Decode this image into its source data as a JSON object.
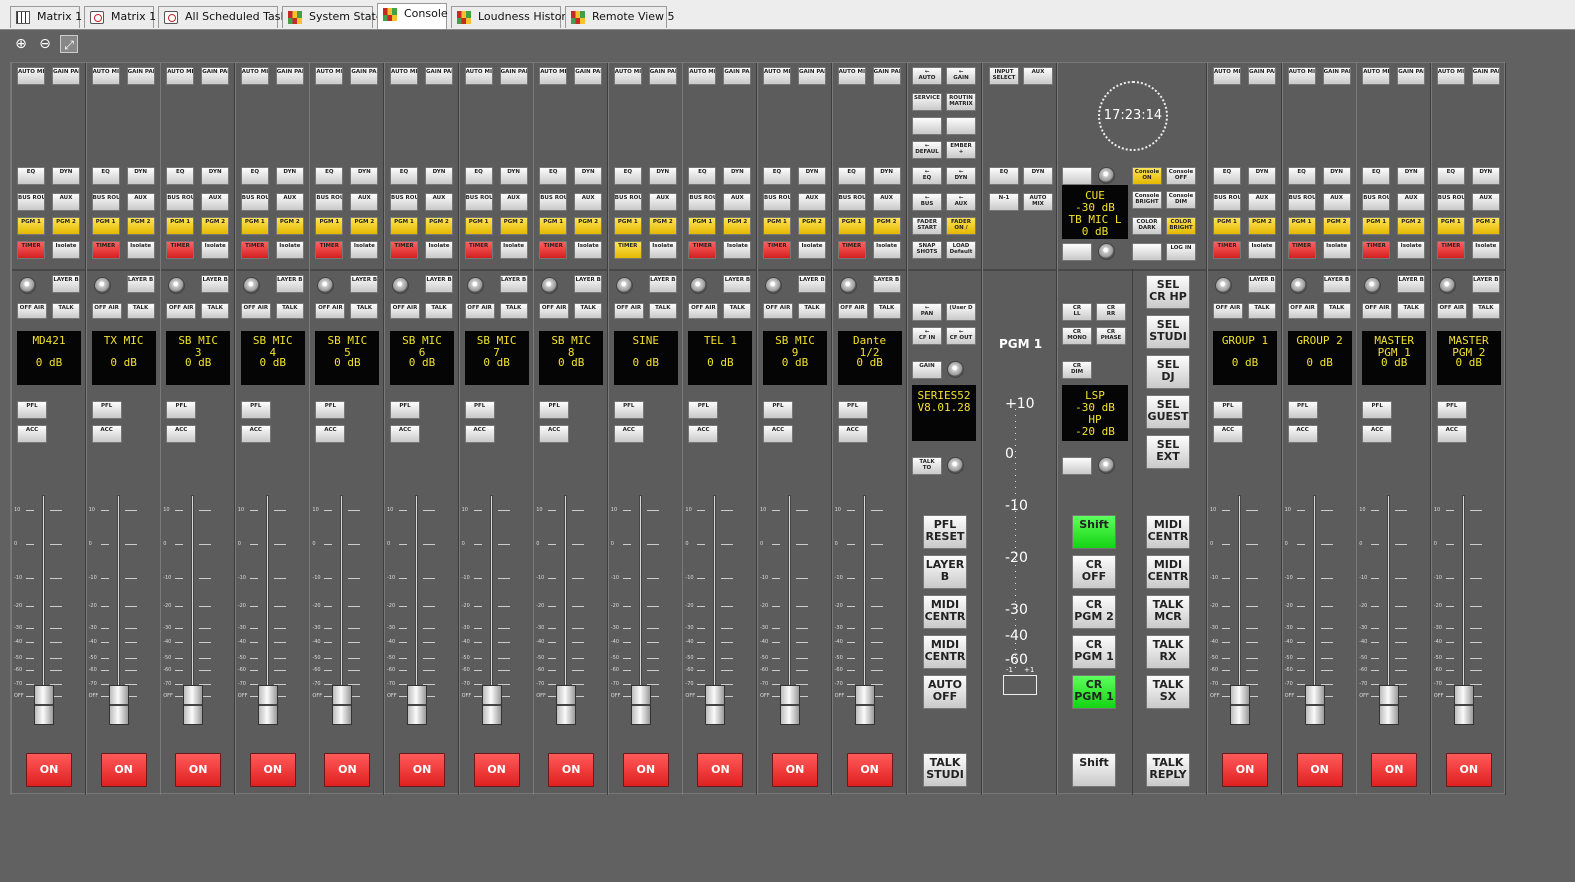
{
  "tabs": [
    {
      "label": "Matrix 1",
      "icon": "grid-icon",
      "active": false
    },
    {
      "label": "Matrix 1",
      "icon": "scheduler-icon",
      "active": false
    },
    {
      "label": "All Scheduled Tasks",
      "icon": "scheduler-icon",
      "active": false
    },
    {
      "label": "System State",
      "icon": "status-color-icon",
      "active": false
    },
    {
      "label": "Console",
      "icon": "status-color-icon",
      "active": true
    },
    {
      "label": "Loudness History",
      "icon": "status-color-icon",
      "active": false
    },
    {
      "label": "Remote View 5",
      "icon": "status-color-icon",
      "active": false
    }
  ],
  "toolbar": {
    "zoom_in": "zoom-in-icon",
    "zoom_out": "zoom-out-icon",
    "fit": "fit-screen-icon"
  },
  "labels": {
    "auto_mix": "AUTO MIX",
    "gain_pan": "GAIN PAN",
    "eq": "EQ",
    "dyn": "DYN",
    "bus_route": "BUS ROUTE",
    "aux": "AUX",
    "pgm1": "PGM 1",
    "pgm2": "PGM 2",
    "timer": "TIMER",
    "isolate": "Isolate",
    "layer_b": "LAYER B",
    "off_air": "OFF AIR",
    "talk": "TALK",
    "pfl": "PFL",
    "acc": "ACC",
    "on": "ON"
  },
  "channels": [
    {
      "name": "MD421",
      "level": "0 dB",
      "timer": "red"
    },
    {
      "name": "TX MIC",
      "level": "0 dB",
      "timer": "red"
    },
    {
      "name": "SB MIC\n3",
      "level": "0 dB",
      "timer": "red"
    },
    {
      "name": "SB MIC\n4",
      "level": "0 dB",
      "timer": "red"
    },
    {
      "name": "SB MIC\n5",
      "level": "0 dB",
      "timer": "red"
    },
    {
      "name": "SB MIC\n6",
      "level": "0 dB",
      "timer": "red"
    },
    {
      "name": "SB MIC\n7",
      "level": "0 dB",
      "timer": "red"
    },
    {
      "name": "SB MIC\n8",
      "level": "0 dB",
      "timer": "red"
    },
    {
      "name": "SINE",
      "level": "0 dB",
      "timer": "yellow"
    },
    {
      "name": "TEL 1",
      "level": "0 dB",
      "timer": "red"
    },
    {
      "name": "SB MIC\n9",
      "level": "0 dB",
      "timer": "red"
    },
    {
      "name": "Dante\n1/2",
      "level": "0 dB",
      "timer": "red"
    }
  ],
  "groups": [
    {
      "name": "GROUP 1",
      "level": "0 dB"
    },
    {
      "name": "GROUP 2",
      "level": "0 dB"
    },
    {
      "name": "MASTER\nPGM 1",
      "level": "0 dB"
    },
    {
      "name": "MASTER\nPGM 2",
      "level": "0 dB"
    }
  ],
  "fader_ticks": [
    "10",
    "0",
    "-10",
    "-20",
    "-30",
    "-40",
    "-50",
    "-60",
    "-70",
    "OFF"
  ],
  "service": {
    "b1": "←\nAUTO",
    "b2": "←\nGAIN",
    "b3": "SERVICE",
    "b4": "ROUTIN\nMATRIX",
    "b5": "",
    "b6": "",
    "b7": "←\nDEFAUL",
    "b8": "EMBER\n+",
    "b9": "←\nEQ",
    "b10": "←\nDYN",
    "b11": "←\nBUS",
    "b12": "←\nAUX",
    "b13": "FADER\nSTART",
    "b14": "FADER\nON /",
    "b15": "SNAP\nSHOTS",
    "b16": "LOAD\nDefault",
    "pan": "←\nPAN",
    "user": "(User D",
    "cfin": "←\nCF IN",
    "cfout": "←\nCF OUT",
    "gain": "GAIN",
    "version": "SERIES52\nV8.01.28",
    "talk_to": "TALK\nTO",
    "pfl_reset": "PFL\nRESET",
    "layer_b": "LAYER\nB",
    "midi1": "MIDI\nCENTR",
    "midi2": "MIDI\nCENTR",
    "auto_off": "AUTO\nOFF",
    "talk_studi": "TALK\nSTUDI"
  },
  "input": {
    "select": "INPUT\nSELECT",
    "aux": "AUX",
    "eq": "EQ",
    "dyn": "DYN",
    "n1": "N-1",
    "auto_mix": "AUTO\nMIX"
  },
  "pgm": {
    "label": "PGM 1",
    "scale": [
      "+10",
      "0",
      "-10",
      "-20",
      "-30",
      "-40",
      "-60"
    ],
    "meter_l": "-1",
    "meter_r": "+1"
  },
  "monitor": {
    "clock": "17:23:14",
    "cue_display": "CUE\n-30 dB\nTB MIC L\n0 dB",
    "console_on": "Console\nON",
    "console_off": "Console\nOFF",
    "console_bright": "Console\nBRIGHT",
    "console_dim": "Console\nDIM",
    "color_dark": "COLOR\nDARK",
    "color_bright": "COLOR\nBRIGHT",
    "login": "LOG IN",
    "cr_ll": "CR\nLL",
    "cr_rr": "CR\nRR",
    "cr_mono": "CR\nMONO",
    "cr_phase": "CR\nPHASE",
    "cr_dim": "CR\nDIM",
    "lsp_display": "LSP\n-30 dB\nHP\n-20 dB",
    "shift": "Shift",
    "cr_off": "CR\nOFF",
    "cr_pgm2": "CR\nPGM 2",
    "cr_pgm1": "CR\nPGM 1",
    "cr_pgm1b": "CR\nPGM 1",
    "shift2": "Shift"
  },
  "sel": {
    "cr_hp": "SEL\nCR HP",
    "studi": "SEL\nSTUDI",
    "dj": "SEL\nDJ",
    "guest": "SEL\nGUEST",
    "ext": "SEL\nEXT",
    "midi1": "MIDI\nCENTR",
    "midi2": "MIDI\nCENTR",
    "talk_mcr": "TALK\nMCR",
    "talk_rx": "TALK\nRX",
    "talk_sx": "TALK\nSX",
    "talk_reply": "TALK\nREPLY"
  },
  "colors": {
    "on": "#e02020",
    "pgm": "#e5b800",
    "shift": "#14d414",
    "display_text": "#f2e22a"
  }
}
